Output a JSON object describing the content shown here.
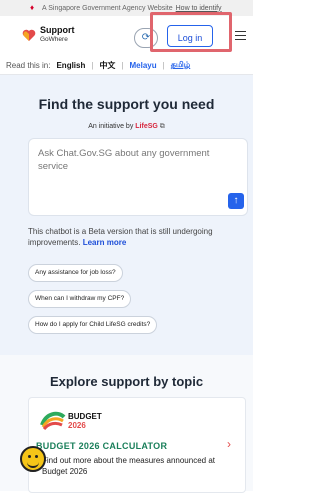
{
  "gov_banner": {
    "text": "A Singapore Government Agency Website",
    "link": "How to identify"
  },
  "header": {
    "logo_title": "Support",
    "logo_subtitle": "GoWhere",
    "login_label": "Log in"
  },
  "language_bar": {
    "label": "Read this in:",
    "english": "English",
    "chinese": "中文",
    "malay": "Melayu",
    "tamil": "தமிழ்"
  },
  "hero": {
    "title": "Find the support you need",
    "initiative_prefix": "An initiative by",
    "initiative_brand": "LifeSG",
    "chat_placeholder": "Ask Chat.Gov.SG about any government service",
    "beta_note": "This chatbot is a Beta version that is still undergoing improvements.",
    "learn_more": "Learn more",
    "suggestions": [
      "Any assistance for job loss?",
      "When can I withdraw my CPF?",
      "How do I apply for Child LifeSG credits?"
    ]
  },
  "topics": {
    "title": "Explore support by topic",
    "card": {
      "logo_word": "BUDGET",
      "logo_year": "2026",
      "title": "BUDGET 2026 CALCULATOR",
      "description": "Find out more about the measures announced at Budget 2026"
    }
  },
  "colors": {
    "primary": "#2563eb",
    "highlight_outline": "#e0656d",
    "hero_bg": "#eef3fb",
    "card_title": "#1a7f5a"
  }
}
